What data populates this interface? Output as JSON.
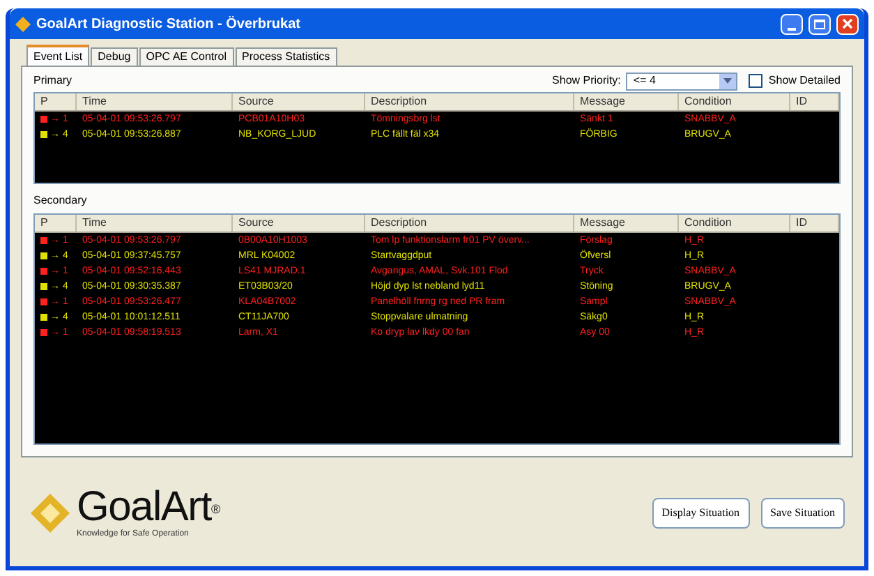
{
  "window": {
    "title": "GoalArt Diagnostic Station - Överbrukat"
  },
  "tabs": [
    {
      "label": "Event List",
      "selected": true
    },
    {
      "label": "Debug",
      "selected": false
    },
    {
      "label": "OPC AE Control",
      "selected": false
    },
    {
      "label": "Process Statistics",
      "selected": false
    }
  ],
  "primary": {
    "title": "Primary",
    "show_priority_label": "Show Priority:",
    "show_priority_value": "<= 4",
    "show_detailed": {
      "label": "Show Detailed",
      "checked": false
    },
    "columns": [
      "P",
      "Time",
      "Source",
      "Description",
      "Message",
      "Condition",
      "ID"
    ],
    "rows": [
      {
        "arrow": "→",
        "priority": "1",
        "time": "05-04-01 09:53:26.797",
        "source": "PCB01A10H03",
        "description": "Tömningsbrg lst",
        "message": "Sänkt 1",
        "condition": "SNABBV_A",
        "color": "#ff2020"
      },
      {
        "arrow": "→",
        "priority": "4",
        "time": "05-04-01 09:53:26.887",
        "source": "NB_KORG_LJUD",
        "description": "PLC fällt fäl x34",
        "message": "FÖRBIG",
        "condition": "BRUGV_A",
        "color": "#e0e000"
      }
    ]
  },
  "secondary": {
    "title": "Secondary",
    "columns": [
      "P",
      "Time",
      "Source",
      "Description",
      "Message",
      "Condition",
      "ID"
    ],
    "rows": [
      {
        "arrow": "→",
        "priority": "1",
        "time": "05-04-01 09:53:26.797",
        "source": "0B00A10H1003",
        "description": "Tom lp funktionslarm fr01 PV överv...",
        "message": "Förslag",
        "condition": "H_R",
        "color": "#ff2020"
      },
      {
        "arrow": "→",
        "priority": "4",
        "time": "05-04-01 09:37:45.757",
        "source": "MRL K04002",
        "description": "Startvaggdput",
        "message": "Öfversl",
        "condition": "H_R",
        "color": "#e0e000"
      },
      {
        "arrow": "→",
        "priority": "1",
        "time": "05-04-01 09:52:16.443",
        "source": "LS41 MJRAD.1",
        "description": "Avgangus, AMAL, Svk.101 Flod",
        "message": "Tryck",
        "condition": "SNABBV_A",
        "color": "#ff2020"
      },
      {
        "arrow": "→",
        "priority": "4",
        "time": "05-04-01 09:30:35.387",
        "source": "ET03B03/20",
        "description": "Höjd dyp lst nebland lyd11",
        "message": "Stöning",
        "condition": "BRUGV_A",
        "color": "#e0e000"
      },
      {
        "arrow": "→",
        "priority": "1",
        "time": "05-04-01 09:53:26.477",
        "source": "KLA04B7002",
        "description": "Panelhöll fnrng rg ned PR fram",
        "message": "Sampl",
        "condition": "SNABBV_A",
        "color": "#ff2020"
      },
      {
        "arrow": "→",
        "priority": "4",
        "time": "05-04-01 10:01:12.511",
        "source": "CT11JA700",
        "description": "Stoppvalare ulmatning",
        "message": "Säkg0",
        "condition": "H_R",
        "color": "#e0e000"
      },
      {
        "arrow": "→",
        "priority": "1",
        "time": "05-04-01 09:58:19.513",
        "source": "Larm, X1",
        "description": "Ko dryp lav lkdy 00 fan",
        "message": "Asy 00",
        "condition": "H_R",
        "color": "#ff2020"
      }
    ]
  },
  "logo": {
    "name": "GoalArt",
    "mark": "®",
    "tagline": "Knowledge for Safe Operation"
  },
  "buttons": [
    "Display Situation",
    "Save Situation"
  ]
}
